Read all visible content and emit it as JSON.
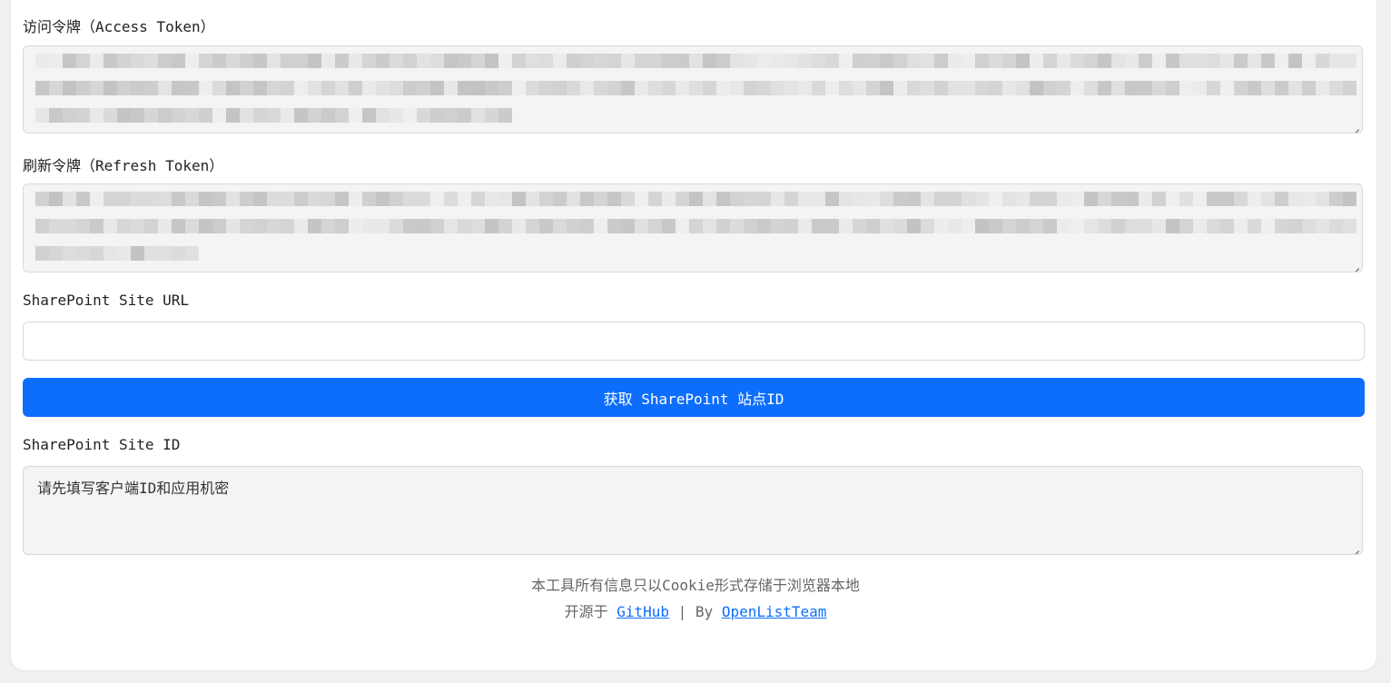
{
  "access_token": {
    "label": "访问令牌（Access Token）"
  },
  "refresh_token": {
    "label": "刷新令牌（Refresh Token）"
  },
  "site_url": {
    "label": "SharePoint Site URL",
    "value": "",
    "placeholder": ""
  },
  "fetch_button": {
    "label": "获取 SharePoint 站点ID"
  },
  "site_id": {
    "label": "SharePoint Site ID",
    "value": "请先填写客户端ID和应用机密"
  },
  "footer": {
    "notice": "本工具所有信息只以Cookie形式存储于浏览器本地",
    "open_source_prefix": "开源于",
    "github_link": "GitHub",
    "separator": "| By",
    "team_link": "OpenListTeam"
  },
  "colors": {
    "primary": "#0d6efd",
    "field_bg": "#f4f4f4",
    "page_bg": "#f0f0f0"
  }
}
